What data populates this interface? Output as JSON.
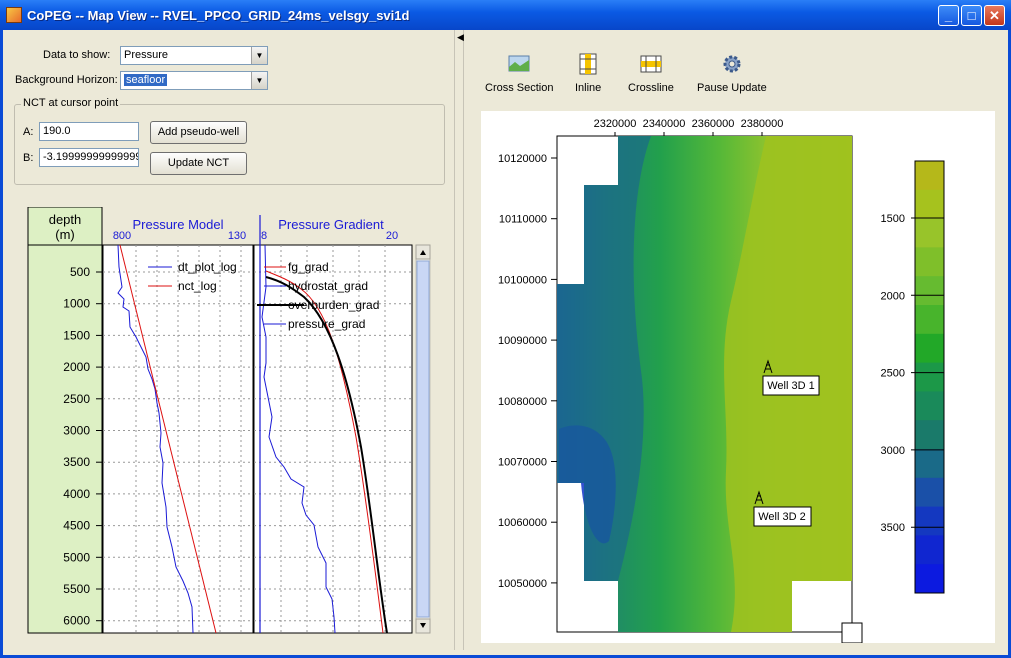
{
  "window": {
    "title": "CoPEG -- Map View -- RVEL_PPCO_GRID_24ms_velsgy_svi1d",
    "minimize_label": "_",
    "maximize_label": "□",
    "close_label": "✕"
  },
  "controls": {
    "data_label": "Data to show:",
    "data_value": "Pressure",
    "horizon_label": "Background Horizon:",
    "horizon_value": "seafloor"
  },
  "nct": {
    "group_title": "NCT at cursor point",
    "a_label": "A:",
    "a_value": "190.0",
    "b_label": "B:",
    "b_value": "-3.19999999999999",
    "add_well_label": "Add pseudo-well",
    "update_label": "Update NCT"
  },
  "log": {
    "depth_header": "depth",
    "depth_unit": "(m)",
    "depth_ticks": [
      "500",
      "1000",
      "1500",
      "2000",
      "2500",
      "3000",
      "3500",
      "4000",
      "4500",
      "5000",
      "5500",
      "6000"
    ],
    "model_title": "Pressure Model",
    "model_min": "800",
    "model_max": "130",
    "grad_title": "Pressure Gradient",
    "grad_min": "8",
    "grad_max": "20",
    "model_legend": [
      "dt_plot_log",
      "nct_log"
    ],
    "grad_legend": [
      "fg_grad",
      "hydrostat_grad",
      "overburden_grad",
      "pressure_grad"
    ]
  },
  "toolbar": {
    "cross_section": "Cross Section",
    "inline": "Inline",
    "crossline": "Crossline",
    "pause": "Pause Update"
  },
  "map": {
    "x_ticks": [
      "2320000",
      "2340000",
      "2360000",
      "2380000"
    ],
    "y_ticks": [
      "10120000",
      "10110000",
      "10100000",
      "10090000",
      "10080000",
      "10070000",
      "10060000",
      "10050000"
    ],
    "wells": [
      "Well 3D 1",
      "Well 3D 2"
    ],
    "colorbar_ticks": [
      "1500",
      "2000",
      "2500",
      "3000",
      "3500"
    ]
  },
  "colors": {
    "title_blue": "#0b5ae4",
    "depth_panel": "#ddf0c4",
    "axis_title_blue": "#1a1ad6"
  }
}
